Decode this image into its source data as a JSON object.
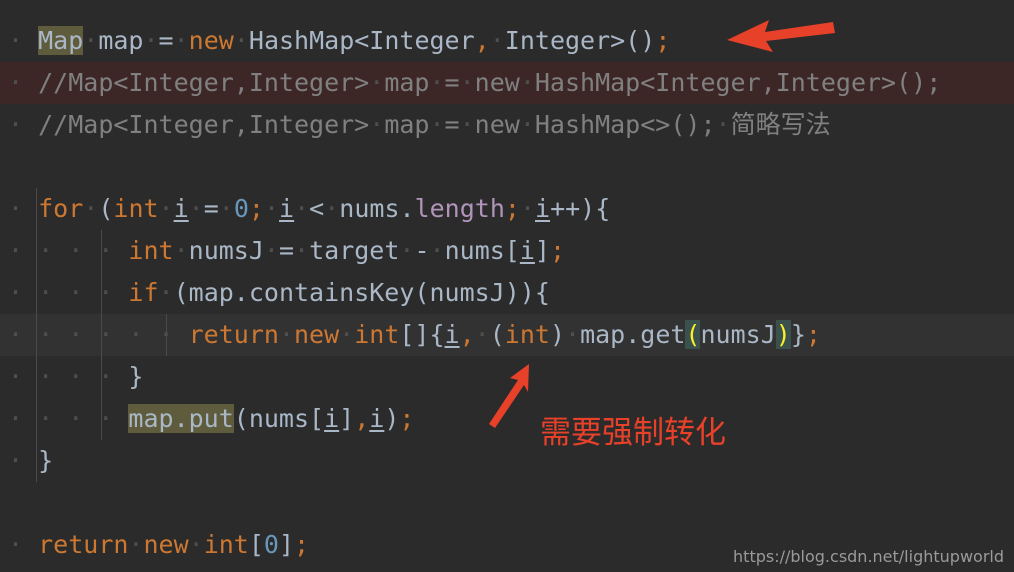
{
  "editor": {
    "theme": "darcula",
    "background_color": "#2b2b2b",
    "caret_line_color": "#323232",
    "comment_highlight_color": "#3d2626",
    "usage_highlight_color": "#5f5c3d",
    "bracket_highlight_color": "#3b514d",
    "bracket_text_color": "#ffef28",
    "keyword_color": "#cc7832",
    "number_color": "#6897bb",
    "comment_color": "#808080",
    "field_color": "#b294bb",
    "default_text_color": "#a9b7c6",
    "annotation_color": "#e8412a"
  },
  "code": {
    "lines": [
      {
        "n": 1,
        "text": "  Map map = new HashMap<Integer, Integer>();",
        "tokens": {
          "type_name": "Map",
          "variable": "map",
          "assign": "=",
          "keyword_new": "new",
          "generic_type": "HashMap<Integer, Integer>();"
        }
      },
      {
        "n": 2,
        "text": "  //Map<Integer,Integer> map = new HashMap<Integer,Integer>();"
      },
      {
        "n": 3,
        "text": "  //Map<Integer,Integer> map = new HashMap<>(); 简略写法",
        "cn_note": "简略写法"
      },
      {
        "n": 4,
        "text": ""
      },
      {
        "n": 5,
        "text": "  for (int i = 0; i < nums.length; i++){",
        "tokens": {
          "keyword_for": "for",
          "keyword_int": "int",
          "var_i": "i",
          "zero": "0",
          "array": "nums",
          "field_length": "length",
          "increment": "i++"
        }
      },
      {
        "n": 6,
        "text": "      int numsJ = target - nums[i];",
        "tokens": {
          "keyword_int": "int",
          "variable": "numsJ",
          "param": "target",
          "array": "nums",
          "index": "i"
        }
      },
      {
        "n": 7,
        "text": "      if (map.containsKey(numsJ)){",
        "tokens": {
          "keyword_if": "if",
          "call": "map.containsKey(numsJ)"
        }
      },
      {
        "n": 8,
        "text": "          return new int[]{i, (int) map.get(numsJ)};",
        "tokens": {
          "keyword_return": "return",
          "keyword_new": "new",
          "keyword_int": "int",
          "var_i": "i",
          "cast": "(int)",
          "call": "map.get",
          "open_bracket": "(",
          "arg": "numsJ",
          "close_bracket": ")"
        },
        "caret_line": true
      },
      {
        "n": 9,
        "text": "      }"
      },
      {
        "n": 10,
        "text": "      map.put(nums[i],i);",
        "tokens": {
          "highlighted": "map.put",
          "array": "nums",
          "index": "i",
          "arg": "i"
        }
      },
      {
        "n": 11,
        "text": "  }"
      },
      {
        "n": 12,
        "text": ""
      },
      {
        "n": 13,
        "text": ""
      },
      {
        "n": 14,
        "text": "  return new int[0];",
        "tokens": {
          "keyword_return": "return",
          "keyword_new": "new",
          "keyword_int": "int",
          "zero": "0"
        }
      }
    ]
  },
  "annotations": {
    "arrow_top": {
      "direction": "left",
      "color": "#e8412a",
      "points_at": "HashMap<Integer, Integer>();"
    },
    "arrow_bottom": {
      "direction": "up-right",
      "color": "#e8412a",
      "points_at": "(int) cast in return statement"
    },
    "note_text": "需要强制转化"
  },
  "watermark": {
    "text": "https://blog.csdn.net/lightupworld"
  }
}
